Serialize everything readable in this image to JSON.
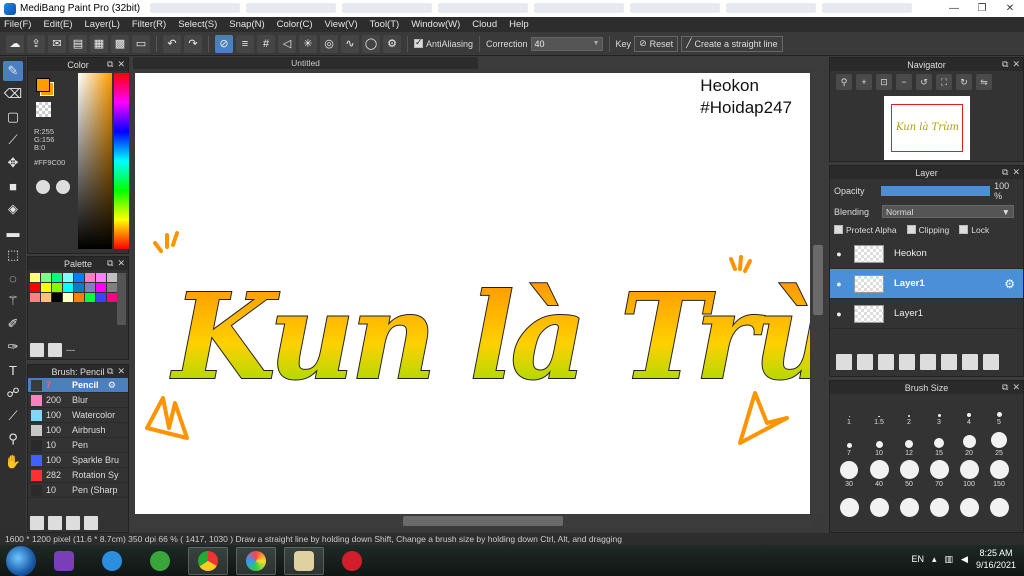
{
  "app": {
    "title": "MediBang Paint Pro (32bit)",
    "accent": "#4a7fc0"
  },
  "menu": [
    "File(F)",
    "Edit(E)",
    "Layer(L)",
    "Filter(R)",
    "Select(S)",
    "Snap(N)",
    "Color(C)",
    "View(V)",
    "Tool(T)",
    "Window(W)",
    "Cloud",
    "Help"
  ],
  "toolbar": {
    "antialiasing_label": "AntiAliasing",
    "correction_label": "Correction",
    "correction_value": "40",
    "key_label": "Key",
    "reset_label": "Reset",
    "straight_line_label": "Create a straight line"
  },
  "color_panel": {
    "title": "Color",
    "r": "R:255",
    "g": "G:156",
    "b": "B:0",
    "hex": "#FF9C00",
    "current_color": "#ff9c00"
  },
  "palette_panel": {
    "title": "Palette",
    "footer_text": "---",
    "colors": [
      "#ffff80",
      "#80ff80",
      "#00ff80",
      "#80ffff",
      "#0080ff",
      "#ff80c0",
      "#ff80ff",
      "#c0c0c0",
      "#ff0000",
      "#ffff00",
      "#80ff00",
      "#00ffff",
      "#0080c0",
      "#8080c0",
      "#ff00ff",
      "#808080",
      "#ff8080",
      "#ffc080",
      "#000000",
      "#ffffc0",
      "#ff8000",
      "#00ff40",
      "#4040ff",
      "#ff0080"
    ]
  },
  "brush_panel": {
    "title": "Brush: Pencil",
    "items": [
      {
        "size": "7",
        "name": "Pencil",
        "color": "#3a3a3a"
      },
      {
        "size": "200",
        "name": "Blur",
        "color": "#ff80c0"
      },
      {
        "size": "100",
        "name": "Watercolor",
        "color": "#80d8ff"
      },
      {
        "size": "100",
        "name": "Airbrush",
        "color": "#c8c8c8"
      },
      {
        "size": "10",
        "name": "Pen",
        "color": "#2a2a2a"
      },
      {
        "size": "100",
        "name": "Sparkle Bru",
        "color": "#4060ff"
      },
      {
        "size": "282",
        "name": "Rotation Sy",
        "color": "#ff3030"
      },
      {
        "size": "10",
        "name": "Pen (Sharp",
        "color": "#2a2a2a"
      }
    ]
  },
  "document": {
    "tab_title": "Untitled",
    "watermark_line1": "Heokon",
    "watermark_line2": "#Hoidap247",
    "artwork_text": "Kun là Trùm"
  },
  "navigator": {
    "title": "Navigator",
    "thumb_text": "Kun là Trùm"
  },
  "layer_panel": {
    "title": "Layer",
    "opacity_label": "Opacity",
    "opacity_value": "100 %",
    "opacity_fraction": 1.0,
    "blending_label": "Blending",
    "blending_value": "Normal",
    "protect_alpha": "Protect Alpha",
    "clipping": "Clipping",
    "lock": "Lock",
    "layers": [
      {
        "name": "Heokon",
        "selected": false
      },
      {
        "name": "Layer1",
        "selected": true
      },
      {
        "name": "Layer1",
        "selected": false
      }
    ]
  },
  "brush_size_panel": {
    "title": "Brush Size",
    "sizes": [
      "1",
      "1.5",
      "2",
      "3",
      "4",
      "5",
      "7",
      "10",
      "12",
      "15",
      "20",
      "25",
      "30",
      "40",
      "50",
      "70",
      "100",
      "150",
      "",
      "",
      "",
      "",
      "",
      ""
    ]
  },
  "status_bar": {
    "text": "1600 * 1200 pixel  (11.6 * 8.7cm)  350 dpi  66 %   ( 1417, 1030 )  Draw a straight line by holding down Shift, Change a brush size by holding down Ctrl, Alt, and dragging"
  },
  "taskbar": {
    "language": "EN",
    "time": "8:25 AM",
    "date": "9/16/2021"
  }
}
